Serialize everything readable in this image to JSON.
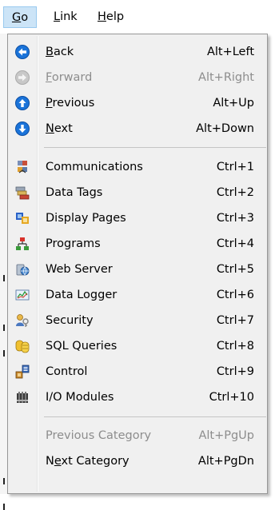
{
  "menubar": {
    "go": {
      "label": "Go",
      "mnemonic": "G",
      "rest": "o"
    },
    "link": {
      "label": "Link",
      "mnemonic": "L",
      "rest": "ink"
    },
    "help": {
      "label": "Help",
      "mnemonic": "H",
      "rest": "elp"
    }
  },
  "go_menu": {
    "nav": [
      {
        "pre": "",
        "mn": "B",
        "post": "ack",
        "shortcut": "Alt+Left",
        "icon": "back-arrow-icon",
        "enabled": true
      },
      {
        "pre": "",
        "mn": "F",
        "post": "orward",
        "shortcut": "Alt+Right",
        "icon": "forward-arrow-icon",
        "enabled": false
      },
      {
        "pre": "",
        "mn": "P",
        "post": "revious",
        "shortcut": "Alt+Up",
        "icon": "up-arrow-icon",
        "enabled": true
      },
      {
        "pre": "",
        "mn": "N",
        "post": "ext",
        "shortcut": "Alt+Down",
        "icon": "down-arrow-icon",
        "enabled": true
      }
    ],
    "categories": [
      {
        "label": "Communications",
        "shortcut": "Ctrl+1",
        "icon": "communications-icon"
      },
      {
        "label": "Data Tags",
        "shortcut": "Ctrl+2",
        "icon": "data-tags-icon"
      },
      {
        "label": "Display Pages",
        "shortcut": "Ctrl+3",
        "icon": "display-pages-icon"
      },
      {
        "label": "Programs",
        "shortcut": "Ctrl+4",
        "icon": "programs-icon"
      },
      {
        "label": "Web Server",
        "shortcut": "Ctrl+5",
        "icon": "web-server-icon"
      },
      {
        "label": "Data Logger",
        "shortcut": "Ctrl+6",
        "icon": "data-logger-icon"
      },
      {
        "label": "Security",
        "shortcut": "Ctrl+7",
        "icon": "security-icon"
      },
      {
        "label": "SQL Queries",
        "shortcut": "Ctrl+8",
        "icon": "sql-queries-icon"
      },
      {
        "label": "Control",
        "shortcut": "Ctrl+9",
        "icon": "control-icon"
      },
      {
        "label": "I/O Modules",
        "shortcut": "Ctrl+10",
        "icon": "io-modules-icon"
      }
    ],
    "category_nav": [
      {
        "pre": "",
        "mn": "",
        "post": "Previous Category",
        "shortcut": "Alt+PgUp",
        "enabled": false
      },
      {
        "pre": "N",
        "mn": "e",
        "post": "xt Category",
        "shortcut": "Alt+PgDn",
        "enabled": true
      }
    ]
  },
  "colors": {
    "menu_bg": "#f0f0f0",
    "selected_menu_bg": "#cce4f7",
    "arrow_blue": "#1a73d9",
    "disabled_text": "#8d8d8d"
  }
}
